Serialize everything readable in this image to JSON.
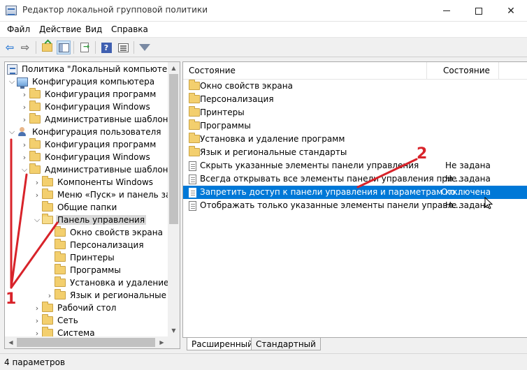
{
  "window": {
    "title": "Редактор локальной групповой политики",
    "controls": {
      "minimize": "",
      "maximize": "",
      "close": "✕"
    }
  },
  "menu": [
    "Файл",
    "Действие",
    "Вид",
    "Справка"
  ],
  "toolbar": {
    "buttons": [
      "back-icon",
      "forward-icon",
      "folder-up-icon",
      "show-hide-tree-icon",
      "export-list-icon",
      "help-icon",
      "properties-icon",
      "filter-icon"
    ]
  },
  "tree": {
    "items": [
      {
        "label": "Политика \"Локальный компьютер\"",
        "icon": "policy-icon",
        "expander": ""
      },
      {
        "label": "Конфигурация компьютера",
        "icon": "computer-icon",
        "expander": "expanded"
      },
      {
        "label": "Конфигурация программ",
        "icon": "folder-icon",
        "expander": "collapsed"
      },
      {
        "label": "Конфигурация Windows",
        "icon": "folder-icon",
        "expander": "collapsed"
      },
      {
        "label": "Административные шаблоны",
        "icon": "folder-icon",
        "expander": "collapsed"
      },
      {
        "label": "Конфигурация пользователя",
        "icon": "user-icon",
        "expander": "expanded"
      },
      {
        "label": "Конфигурация программ",
        "icon": "folder-icon",
        "expander": "collapsed"
      },
      {
        "label": "Конфигурация Windows",
        "icon": "folder-icon",
        "expander": "collapsed"
      },
      {
        "label": "Административные шаблоны",
        "icon": "folder-icon",
        "expander": "expanded"
      },
      {
        "label": "Компоненты Windows",
        "icon": "folder-icon",
        "expander": "collapsed"
      },
      {
        "label": "Меню «Пуск» и панель зада",
        "icon": "folder-icon",
        "expander": "collapsed"
      },
      {
        "label": "Общие папки",
        "icon": "folder-icon",
        "expander": ""
      },
      {
        "label": "Панель управления",
        "icon": "folder-open-icon",
        "expander": "expanded",
        "selected": true
      },
      {
        "label": "Окно свойств экрана",
        "icon": "folder-icon",
        "expander": ""
      },
      {
        "label": "Персонализация",
        "icon": "folder-icon",
        "expander": ""
      },
      {
        "label": "Принтеры",
        "icon": "folder-icon",
        "expander": ""
      },
      {
        "label": "Программы",
        "icon": "folder-icon",
        "expander": ""
      },
      {
        "label": "Установка и удаление пр",
        "icon": "folder-icon",
        "expander": ""
      },
      {
        "label": "Язык и региональные ст",
        "icon": "folder-icon",
        "expander": "collapsed"
      },
      {
        "label": "Рабочий стол",
        "icon": "folder-icon",
        "expander": "collapsed"
      },
      {
        "label": "Сеть",
        "icon": "folder-icon",
        "expander": "collapsed"
      },
      {
        "label": "Система",
        "icon": "folder-icon",
        "expander": "collapsed"
      }
    ]
  },
  "list": {
    "headers": [
      "Состояние",
      "Состояние"
    ],
    "rows": [
      {
        "name": "Окно свойств экрана",
        "state": "",
        "icon": "folder-icon"
      },
      {
        "name": "Персонализация",
        "state": "",
        "icon": "folder-icon"
      },
      {
        "name": "Принтеры",
        "state": "",
        "icon": "folder-icon"
      },
      {
        "name": "Программы",
        "state": "",
        "icon": "folder-icon"
      },
      {
        "name": "Установка и удаление программ",
        "state": "",
        "icon": "folder-icon"
      },
      {
        "name": "Язык и региональные стандарты",
        "state": "",
        "icon": "folder-icon"
      },
      {
        "name": "Скрыть указанные элементы панели управления",
        "state": "Не задана",
        "icon": "setting-icon"
      },
      {
        "name": "Всегда открывать все элементы панели управления при ...",
        "state": "Не задана",
        "icon": "setting-icon"
      },
      {
        "name": "Запретить доступ к панели управления и параметрам ко...",
        "state": "Отключена",
        "icon": "setting-icon",
        "selected": true
      },
      {
        "name": "Отображать только указанные элементы панели управл...",
        "state": "Не задана",
        "icon": "setting-icon"
      }
    ]
  },
  "tabs": [
    "Расширенный",
    "Стандартный"
  ],
  "status": "4 параметров",
  "annotations": {
    "label_1": "1",
    "label_2": "2",
    "color": "#d8232a"
  },
  "colors": {
    "selection": "#0078d7",
    "tree_selection": "#d9d9d9"
  }
}
